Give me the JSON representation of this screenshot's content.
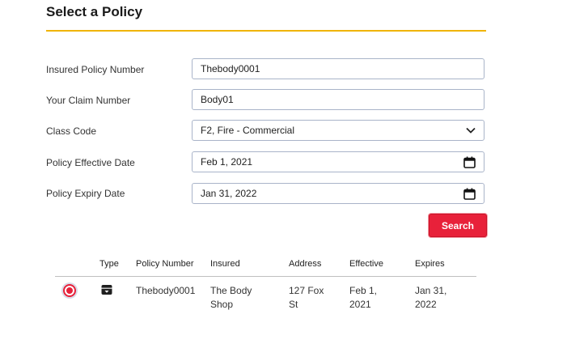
{
  "header": {
    "title": "Select a Policy"
  },
  "form": {
    "insured_policy_number": {
      "label": "Insured Policy Number",
      "value": "Thebody0001"
    },
    "claim_number": {
      "label": "Your Claim Number",
      "value": "Body01"
    },
    "class_code": {
      "label": "Class Code",
      "value": "F2, Fire - Commercial"
    },
    "effective_date": {
      "label": "Policy Effective Date",
      "value": "Feb 1, 2021"
    },
    "expiry_date": {
      "label": "Policy Expiry Date",
      "value": "Jan 31, 2022"
    }
  },
  "search_button": {
    "label": "Search"
  },
  "table": {
    "headers": [
      "Type",
      "Policy Number",
      "Insured",
      "Address",
      "Effective",
      "Expires"
    ],
    "rows": [
      {
        "type_icon": "archive-box-icon",
        "policy_number": "Thebody0001",
        "insured_line1": "The Body",
        "insured_line2": "Shop",
        "address_line1": "127 Fox",
        "address_line2": "St",
        "effective_line1": "Feb 1,",
        "effective_line2": "2021",
        "expires_line1": "Jan 31,",
        "expires_line2": "2022",
        "selected": true
      }
    ]
  },
  "colors": {
    "accent": "#f0b400",
    "primary": "#e8213a"
  }
}
